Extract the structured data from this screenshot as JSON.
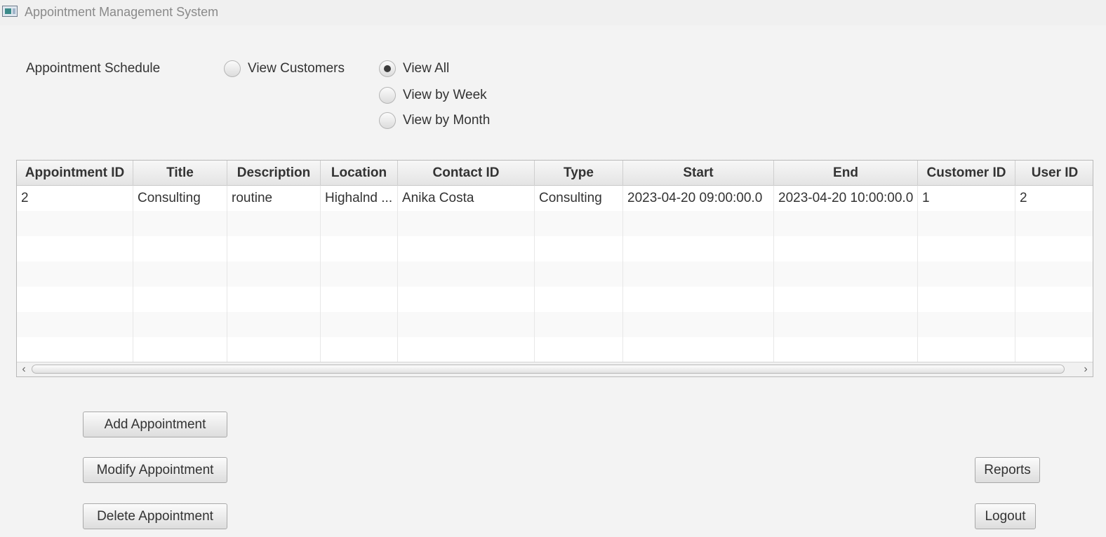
{
  "window": {
    "title": "Appointment Management System"
  },
  "schedule_label": "Appointment Schedule",
  "view_toggle": {
    "customers_label": "View Customers"
  },
  "filters": {
    "selected": "View All",
    "options": [
      "View All",
      "View by Week",
      "View by Month"
    ]
  },
  "table": {
    "columns": [
      "Appointment ID",
      "Title",
      "Description",
      "Location",
      "Contact ID",
      "Type",
      "Start",
      "End",
      "Customer ID",
      "User ID"
    ],
    "rows": [
      [
        "2",
        "Consulting",
        "routine",
        "Highalnd ...",
        "Anika Costa",
        "Consulting",
        "2023-04-20 09:00:00.0",
        "2023-04-20 10:00:00.0",
        "1",
        "2"
      ]
    ],
    "scroll_left_glyph": "‹",
    "scroll_right_glyph": "›"
  },
  "buttons": {
    "add": "Add Appointment",
    "modify": "Modify Appointment",
    "delete": "Delete Appointment",
    "reports": "Reports",
    "logout": "Logout"
  },
  "icons": {
    "app": "app-window-icon",
    "scroll_left": "chevron-left-icon",
    "scroll_right": "chevron-right-icon"
  }
}
